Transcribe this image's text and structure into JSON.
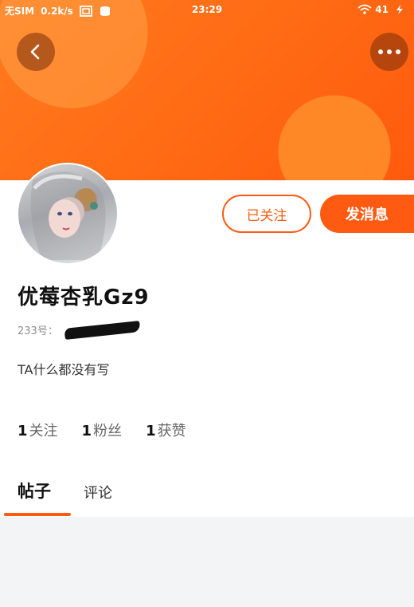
{
  "status_bar": {
    "carrier": "无SIM",
    "speed": "0.2k/s",
    "time": "23:29",
    "battery": "41",
    "icons": [
      "screenshot-icon",
      "storage-icon",
      "wifi-icon",
      "battery-charging-icon"
    ]
  },
  "header": {
    "back_icon": "chevron-left-icon",
    "more_icon": "more-horizontal-icon",
    "accent_color": "#ff6a13"
  },
  "profile": {
    "username": "优莓杏乳Gz9",
    "id_label": "233号：",
    "bio": "TA什么都没有写",
    "follow_button": "已关注",
    "message_button": "发消息"
  },
  "stats": [
    {
      "num": "1",
      "label": "关注"
    },
    {
      "num": "1",
      "label": "粉丝"
    },
    {
      "num": "1",
      "label": "获赞"
    }
  ],
  "tabs": [
    {
      "label": "帖子",
      "active": true
    },
    {
      "label": "评论",
      "active": false
    }
  ]
}
